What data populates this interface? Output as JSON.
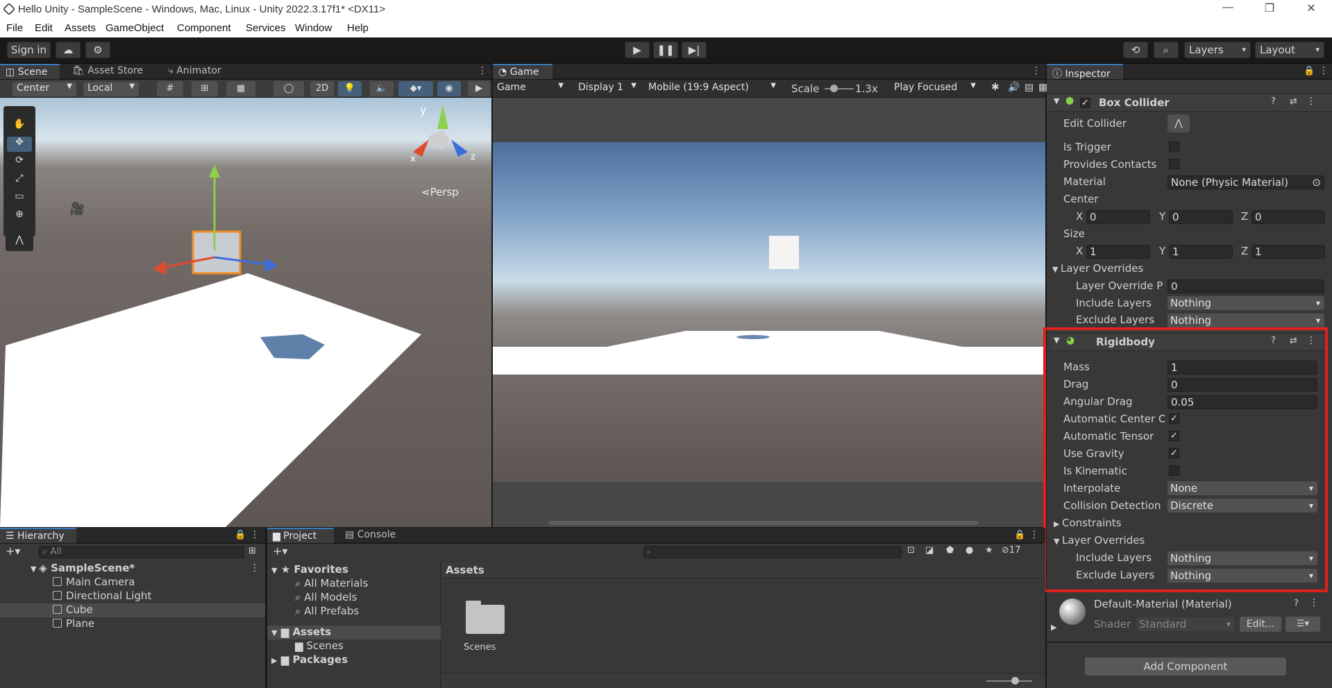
{
  "window": {
    "title": "Hello Unity - SampleScene - Windows, Mac, Linux - Unity 2022.3.17f1* <DX11>"
  },
  "menu": [
    "File",
    "Edit",
    "Assets",
    "GameObject",
    "Component",
    "Services",
    "Window",
    "Help"
  ],
  "toolbar": {
    "sign_in": "Sign in",
    "layers": "Layers",
    "layout": "Layout"
  },
  "scene_panel": {
    "tabs": [
      "Scene",
      "Asset Store",
      "Animator"
    ],
    "pivot": "Center",
    "space": "Local",
    "mode_2d": "2D",
    "persp_label": "Persp",
    "gizmo_axes": {
      "x": "x",
      "y": "y",
      "z": "z"
    }
  },
  "game_panel": {
    "tab": "Game",
    "view": "Game",
    "display": "Display 1",
    "aspect": "Mobile (19:9 Aspect)",
    "scale_label": "Scale",
    "scale_value": "1.3x",
    "play_mode": "Play Focused"
  },
  "inspector": {
    "tab": "Inspector",
    "box_collider": {
      "title": "Box Collider",
      "edit_collider": "Edit Collider",
      "is_trigger": "Is Trigger",
      "provides_contacts": "Provides Contacts",
      "material_label": "Material",
      "material_value": "None (Physic Material)",
      "center_label": "Center",
      "center": {
        "x": "0",
        "y": "0",
        "z": "0"
      },
      "size_label": "Size",
      "size": {
        "x": "1",
        "y": "1",
        "z": "1"
      },
      "layer_overrides": "Layer Overrides",
      "layer_override_priority_label": "Layer Override Pri",
      "layer_override_priority": "0",
      "include_layers_label": "Include Layers",
      "include_layers": "Nothing",
      "exclude_layers_label": "Exclude Layers",
      "exclude_layers": "Nothing"
    },
    "rigidbody": {
      "title": "Rigidbody",
      "mass_label": "Mass",
      "mass": "1",
      "drag_label": "Drag",
      "drag": "0",
      "angular_drag_label": "Angular Drag",
      "angular_drag": "0.05",
      "auto_center_label": "Automatic Center Of",
      "auto_tensor_label": "Automatic Tensor",
      "use_gravity_label": "Use Gravity",
      "is_kinematic_label": "Is Kinematic",
      "interpolate_label": "Interpolate",
      "interpolate": "None",
      "collision_detection_label": "Collision Detection",
      "collision_detection": "Discrete",
      "constraints": "Constraints",
      "layer_overrides": "Layer Overrides",
      "include_layers_label": "Include Layers",
      "include_layers": "Nothing",
      "exclude_layers_label": "Exclude Layers",
      "exclude_layers": "Nothing",
      "checkbox_glyph": "✓"
    },
    "material": {
      "title": "Default-Material (Material)",
      "shader_label": "Shader",
      "shader_value": "Standard",
      "edit_button": "Edit..."
    },
    "add_component": "Add Component",
    "highlight_color": "#e0201c"
  },
  "hierarchy": {
    "tab": "Hierarchy",
    "search_placeholder": "All",
    "scene": "SampleScene*",
    "items": [
      "Main Camera",
      "Directional Light",
      "Cube",
      "Plane"
    ]
  },
  "project": {
    "tabs": [
      "Project",
      "Console"
    ],
    "hidden_count": "17",
    "favorites": "Favorites",
    "favorite_items": [
      "All Materials",
      "All Models",
      "All Prefabs"
    ],
    "assets_root": "Assets",
    "assets_children": [
      "Scenes"
    ],
    "packages": "Packages",
    "breadcrumb": "Assets",
    "folder_items": [
      "Scenes"
    ]
  }
}
